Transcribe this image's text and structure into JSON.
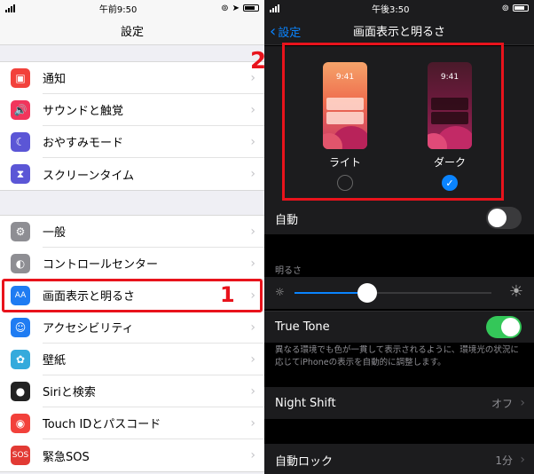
{
  "left": {
    "status": {
      "time": "午前9:50"
    },
    "title": "設定",
    "group1": [
      {
        "label": "通知",
        "icon": "notification-icon",
        "color": "#f2413b"
      },
      {
        "label": "サウンドと触覚",
        "icon": "sound-icon",
        "color": "#f1355c"
      },
      {
        "label": "おやすみモード",
        "icon": "moon-icon",
        "color": "#5b56d6"
      },
      {
        "label": "スクリーンタイム",
        "icon": "hourglass-icon",
        "color": "#5b56d6"
      }
    ],
    "group2": [
      {
        "label": "一般",
        "icon": "gear-icon",
        "color": "#8e8e93"
      },
      {
        "label": "コントロールセンター",
        "icon": "toggles-icon",
        "color": "#8e8e93"
      },
      {
        "label": "画面表示と明るさ",
        "icon": "display-icon",
        "color": "#1f7cf2",
        "glyph": "AA"
      },
      {
        "label": "アクセシビリティ",
        "icon": "accessibility-icon",
        "color": "#1f7cf2"
      },
      {
        "label": "壁紙",
        "icon": "wallpaper-icon",
        "color": "#35aadc"
      },
      {
        "label": "Siriと検索",
        "icon": "siri-icon",
        "color": "#222"
      },
      {
        "label": "Touch IDとパスコード",
        "icon": "fingerprint-icon",
        "color": "#f2413b"
      },
      {
        "label": "緊急SOS",
        "icon": "sos-icon",
        "color": "#e23a34",
        "glyph": "SOS"
      }
    ],
    "step": "1"
  },
  "right": {
    "status": {
      "time": "午後3:50"
    },
    "back_label": "設定",
    "title": "画面表示と明るさ",
    "step": "2",
    "appearance": {
      "light": {
        "label": "ライト",
        "time": "9:41"
      },
      "dark": {
        "label": "ダーク",
        "time": "9:41"
      }
    },
    "auto_label": "自動",
    "brightness_header": "明るさ",
    "brightness_level": 0.37,
    "true_tone_label": "True Tone",
    "true_tone_desc": "異なる環境でも色が一貫して表示されるように、環境光の状況に応じてiPhoneの表示を自動的に調整します。",
    "night_shift": {
      "label": "Night Shift",
      "value": "オフ"
    },
    "auto_lock": {
      "label": "自動ロック",
      "value": "1分"
    }
  },
  "colors": {
    "accent_red": "#e8131c",
    "ios_blue": "#0a84ff",
    "ios_green": "#34c759"
  }
}
